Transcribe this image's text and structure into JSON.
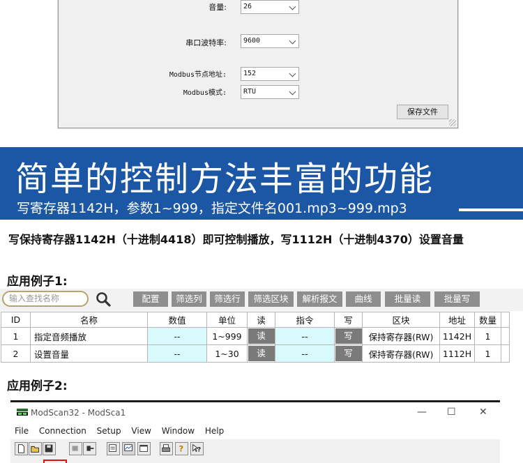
{
  "settings_dialog": {
    "rows": [
      {
        "label": "音量:",
        "value": "26"
      },
      {
        "label": "串口波特率:",
        "value": "9600"
      },
      {
        "label": "Modbus节点地址:",
        "value": "152"
      },
      {
        "label": "Modbus模式:",
        "value": "RTU"
      }
    ],
    "save_button": "保存文件"
  },
  "banner": {
    "title": "简单的控制方法丰富的功能",
    "subtitle": "写寄存器1142H，参数1~999，指定文件名001.mp3~999.mp3",
    "color": "#1b57a5"
  },
  "description": "写保持寄存器1142H（十进制4418）即可控制播放，写1112H（十进制4370）设置音量",
  "example1": {
    "heading": "应用例子1:",
    "search_placeholder": "输入查找名称",
    "search_icon": "magnifier-icon",
    "buttons": [
      "配置",
      "筛选列",
      "筛选行",
      "筛选区块",
      "解析报文",
      "曲线",
      "批量读",
      "批量写"
    ],
    "columns": [
      "ID",
      "名称",
      "数值",
      "单位",
      "读",
      "指令",
      "写",
      "区块",
      "地址",
      "数量"
    ],
    "rows": [
      {
        "id": "1",
        "name": "指定音频播放",
        "value": "--",
        "unit": "1~999",
        "read": "读",
        "cmd": "--",
        "write": "写",
        "block": "保持寄存器(RW)",
        "addr": "1142H",
        "count": "1"
      },
      {
        "id": "2",
        "name": "设置音量",
        "value": "--",
        "unit": "1~30",
        "read": "读",
        "cmd": "--",
        "write": "写",
        "block": "保持寄存器(RW)",
        "addr": "1112H",
        "count": "1"
      }
    ]
  },
  "example2": {
    "heading": "应用例子2:",
    "window_title": "ModScan32 - ModSca1",
    "window_controls": {
      "minimize": "—",
      "maximize": "☐",
      "close": "✕"
    },
    "menu": [
      "File",
      "Connection",
      "Setup",
      "View",
      "Window",
      "Help"
    ],
    "toolbar_icons": [
      "new-icon",
      "open-icon",
      "save-icon",
      "connect-icon",
      "disconnect-icon",
      "display-icon",
      "graph-icon",
      "window-icon",
      "print-icon",
      "help-icon",
      "context-help-icon"
    ],
    "highlight_color": "#e01010"
  }
}
